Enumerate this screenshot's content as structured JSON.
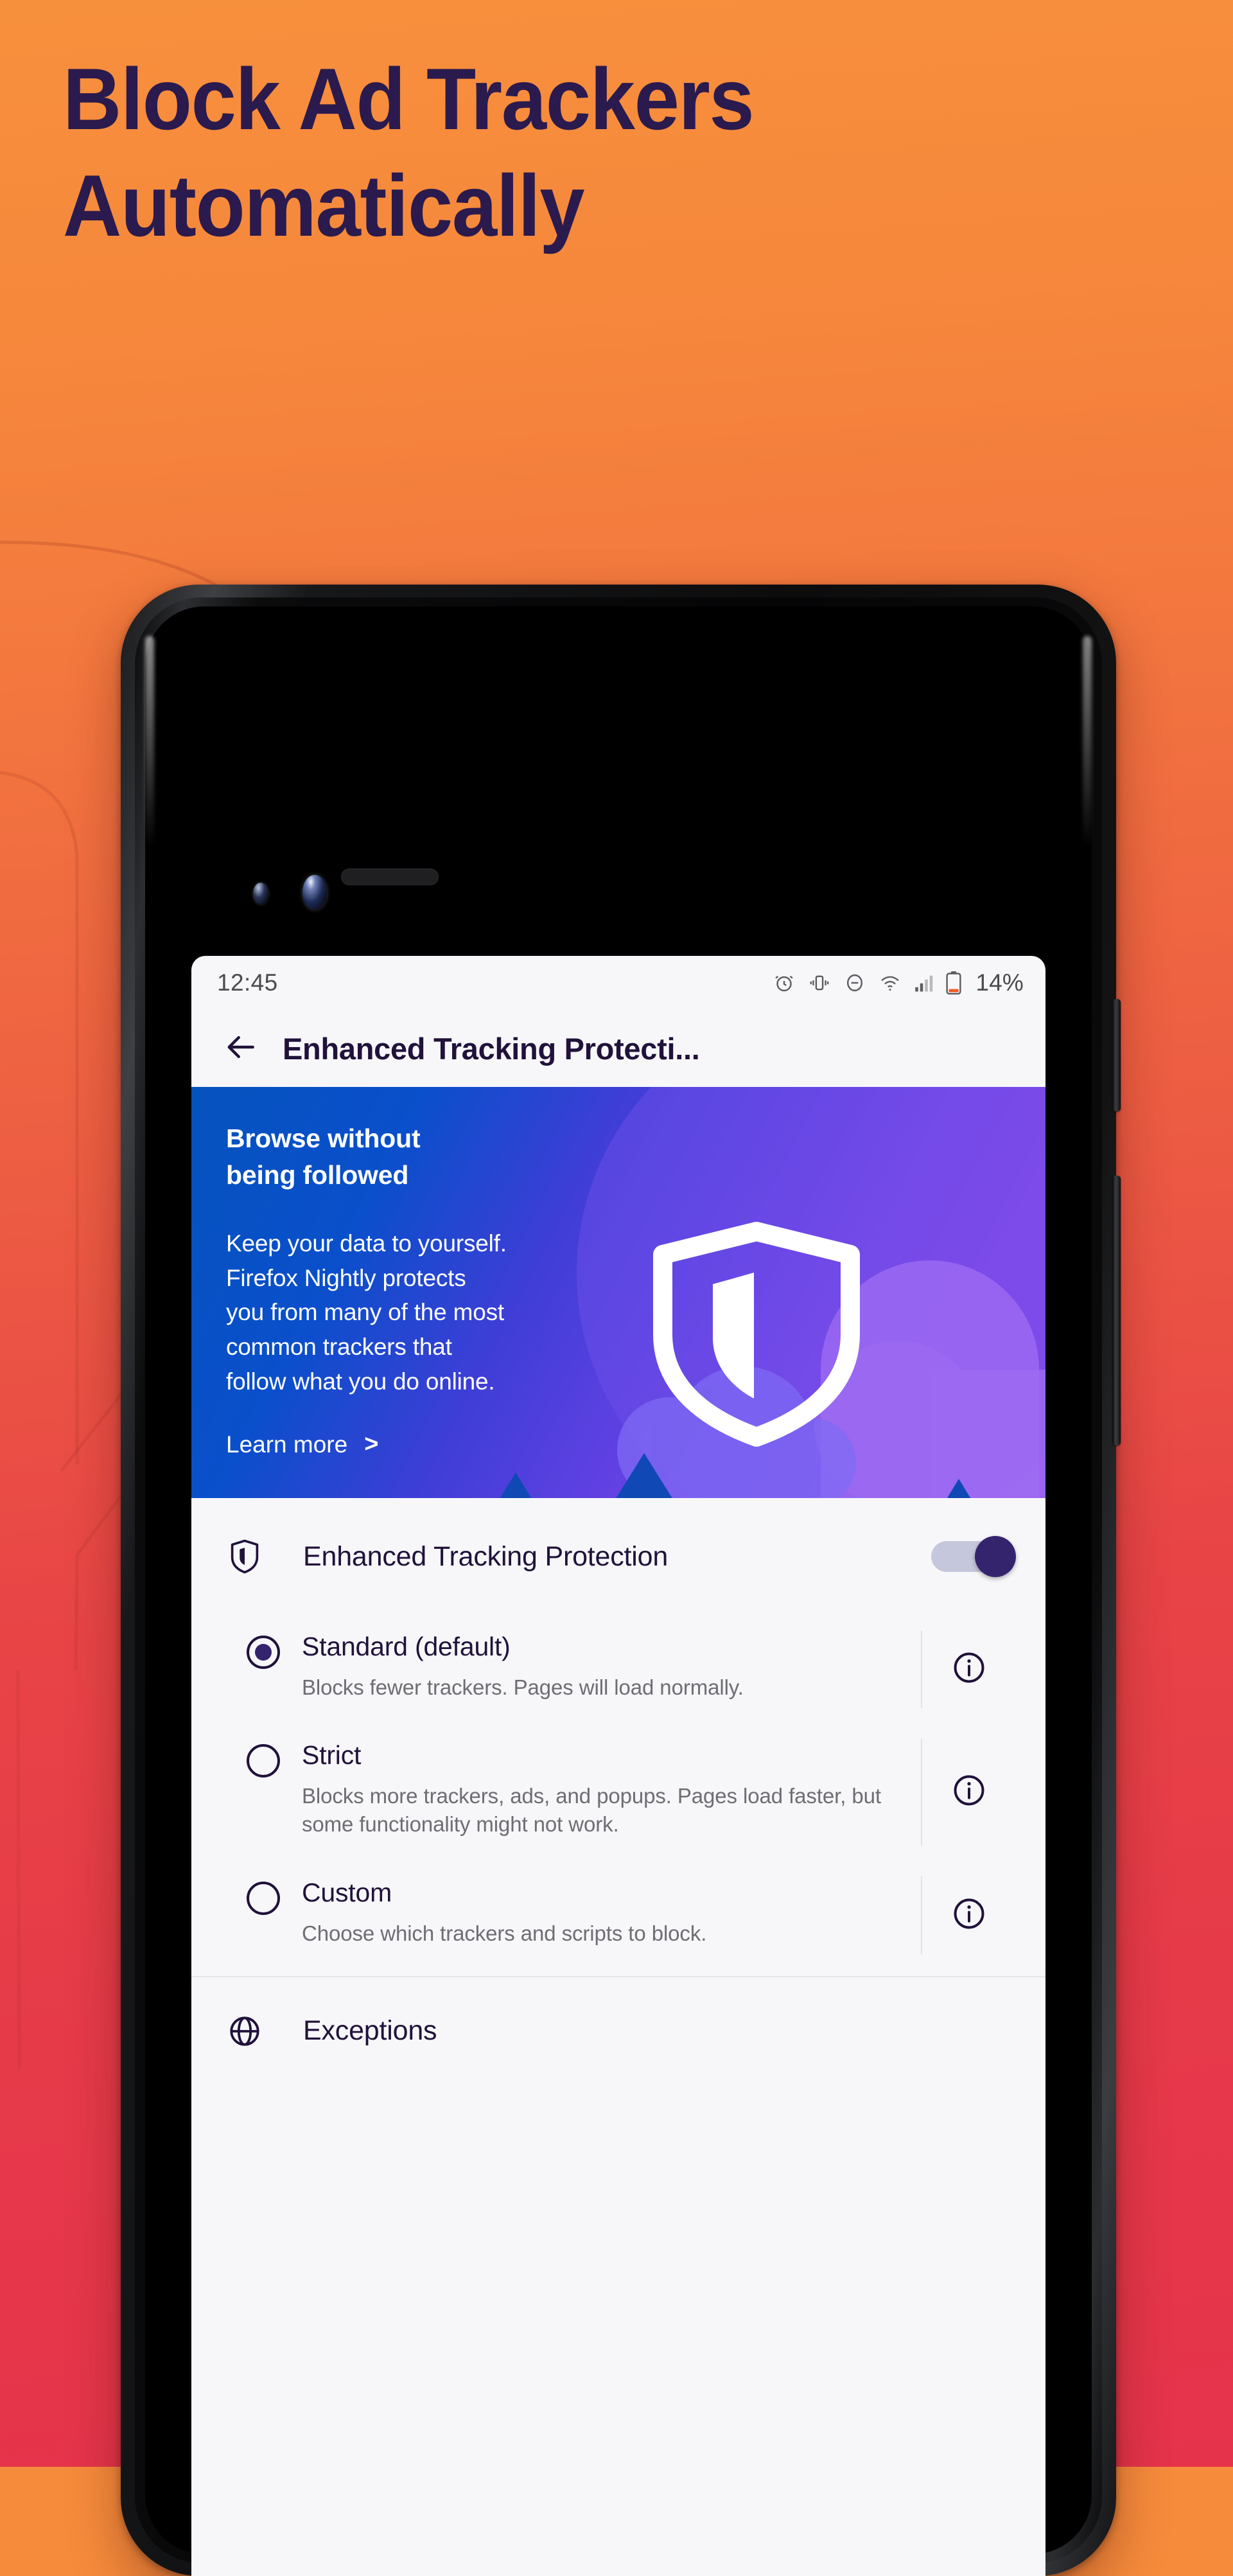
{
  "promo": {
    "headline_line1": "Block Ad Trackers",
    "headline_line2": "Automatically",
    "headline_color": "#2b1a4d",
    "bg_top_color": "#f7903d",
    "bg_bottom_color": "#e5334b"
  },
  "status_bar": {
    "time": "12:45",
    "battery_percent": "14%",
    "icons": [
      "alarm-icon",
      "vibrate-icon",
      "do-not-disturb-icon",
      "wifi-icon",
      "cellular-signal-icon",
      "battery-icon"
    ]
  },
  "app_bar": {
    "back_icon": "back-arrow-icon",
    "title": "Enhanced Tracking Protecti..."
  },
  "banner": {
    "title_line1": "Browse without",
    "title_line2": "being followed",
    "body": "Keep your data to yourself. Firefox Nightly protects you from many of the most common trackers that follow what you do online.",
    "body_line1": "Keep your data to yourself.",
    "body_line2": "Firefox Nightly protects",
    "body_line3": "you from many of the most",
    "body_line4": "common trackers that",
    "body_line5": "follow what you do online.",
    "link_label": "Learn more",
    "link_chevron": ">",
    "gradient_start": "#0553be",
    "gradient_end": "#8e46ea"
  },
  "etp": {
    "icon": "shield-icon",
    "label": "Enhanced Tracking Protection",
    "toggle_state": "on",
    "toggle_on_color": "#34246e",
    "toggle_track_color": "#c5c8dc"
  },
  "options": [
    {
      "id": "standard",
      "title": "Standard (default)",
      "desc": "Blocks fewer trackers. Pages will load normally.",
      "selected": true,
      "info_icon": "info-icon"
    },
    {
      "id": "strict",
      "title": "Strict",
      "desc": "Blocks more trackers, ads, and popups. Pages load faster, but some functionality might not work.",
      "selected": false,
      "info_icon": "info-icon"
    },
    {
      "id": "custom",
      "title": "Custom",
      "desc": "Choose which trackers and scripts to block.",
      "selected": false,
      "info_icon": "info-icon"
    }
  ],
  "exceptions": {
    "icon": "globe-icon",
    "label": "Exceptions"
  }
}
